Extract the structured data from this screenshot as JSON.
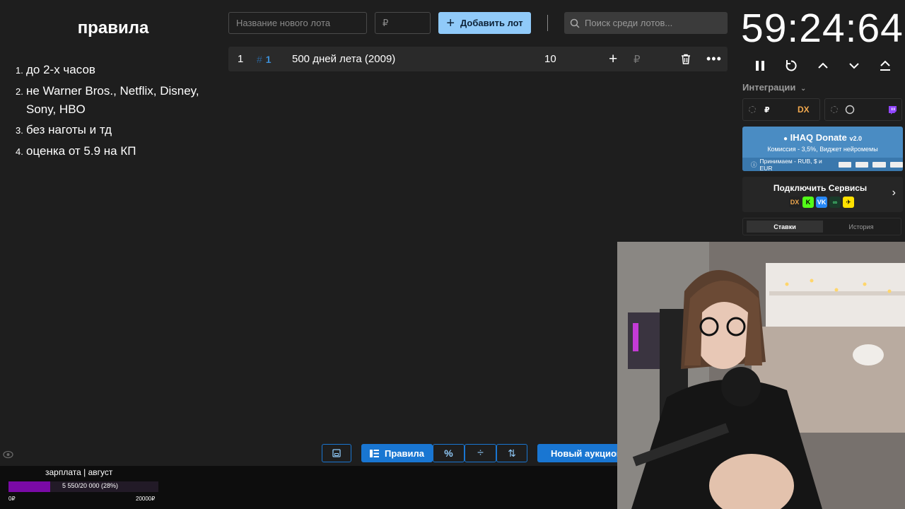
{
  "rules": {
    "title": "правила",
    "items": [
      {
        "num": "1.",
        "text": "до 2-х часов"
      },
      {
        "num": "2.",
        "text": "не Warner Bros., Netflix, Disney, Sony, HBO"
      },
      {
        "num": "3.",
        "text": "без наготы и тд"
      },
      {
        "num": "4.",
        "text": "оценка от 5.9 на КП"
      }
    ]
  },
  "toolbar": {
    "lot_name_placeholder": "Название нового лота",
    "amount_placeholder": "₽",
    "add_label": "Добавить лот",
    "search_placeholder": "Поиск среди лотов..."
  },
  "lots": [
    {
      "index": "1",
      "hash": "#",
      "id": "1",
      "name": "500 дней лета (2009)",
      "amount": "10",
      "currency": "₽"
    }
  ],
  "bottom": {
    "rules_label": "Правила",
    "new_auction_label": "Новый аукцион"
  },
  "salary": {
    "title": "зарплата | август",
    "progress_text": "5 550/20 000 (28%)",
    "progress": 0.28,
    "min": "0₽",
    "max": "20000₽"
  },
  "timer": {
    "value": "59:24:64"
  },
  "integrations": {
    "label": "Интеграции",
    "box1_currency": "₽",
    "box1_logo": "DX"
  },
  "donate": {
    "title": "IHAQ Donate",
    "version": "v2.0",
    "sub": "Комиссия - 3,5%, Виджет нейромемы",
    "foot": "Принимаем - RUB, $ и EUR"
  },
  "services": {
    "title": "Подключить Сервисы",
    "icons": [
      "DX",
      "K",
      "VK",
      "∞",
      "✈"
    ]
  },
  "tabs": {
    "active": "Ставки",
    "other": "История"
  },
  "colors": {
    "accent": "#1976d2",
    "accent_light": "#90caf9",
    "progress_fill": "#7a0aa6",
    "donate": "#4a8cc3"
  }
}
